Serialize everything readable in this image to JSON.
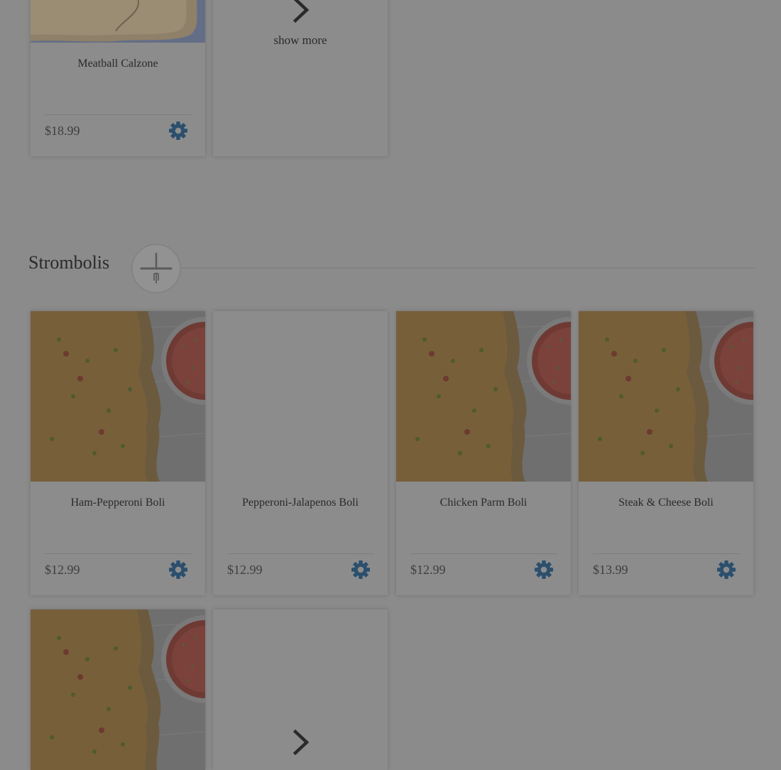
{
  "colors": {
    "page_bg": "#8b8b8b",
    "card_bg": "#8c8c8c",
    "gear": "#2b4f6d",
    "text": "#2a2a2a",
    "price": "#3e3e3e"
  },
  "prev_section": {
    "items": [
      {
        "name": "Meatball Calzone",
        "price": "$18.99",
        "icon": "gear-icon",
        "image": "calzone-photo"
      }
    ],
    "show_more_label": "show more",
    "show_more_icon": "chevron-right-icon"
  },
  "strombolis": {
    "title": "Strombolis",
    "section_icon": "knife-fork-icon",
    "items": [
      {
        "name": "Ham-Pepperoni Boli",
        "price": "$12.99",
        "icon": "gear-icon",
        "image": "stromboli-photo"
      },
      {
        "name": "Pepperoni-Jalapenos Boli",
        "price": "$12.99",
        "icon": "gear-icon",
        "image": ""
      },
      {
        "name": "Chicken Parm Boli",
        "price": "$12.99",
        "icon": "gear-icon",
        "image": "stromboli-photo"
      },
      {
        "name": "Steak & Cheese Boli",
        "price": "$13.99",
        "icon": "gear-icon",
        "image": "stromboli-photo"
      }
    ],
    "show_more_icon": "chevron-right-icon"
  }
}
